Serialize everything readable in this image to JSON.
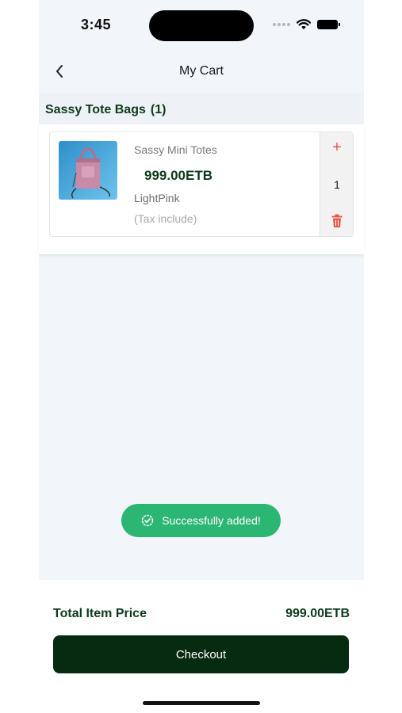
{
  "status_bar": {
    "time": "3:45"
  },
  "header": {
    "title": "My Cart",
    "back_icon": "chevron-left-icon"
  },
  "section": {
    "title": "Sassy Tote Bags",
    "count": "(1)"
  },
  "cart_items": [
    {
      "name": "Sassy Mini Totes",
      "price": "999.00ETB",
      "color": "LightPink",
      "tax_note": "(Tax include)",
      "quantity": "1"
    }
  ],
  "quantity_controls": {
    "plus": "+",
    "plus_color": "#e35b4c",
    "delete_icon": "trash-icon"
  },
  "toast": {
    "message": "Successfully added!",
    "color": "#2bb673",
    "icon": "check-badge-icon"
  },
  "footer": {
    "total_label": "Total Item Price",
    "total_value": "999.00ETB",
    "checkout_label": "Checkout",
    "accent": "#062b10"
  }
}
